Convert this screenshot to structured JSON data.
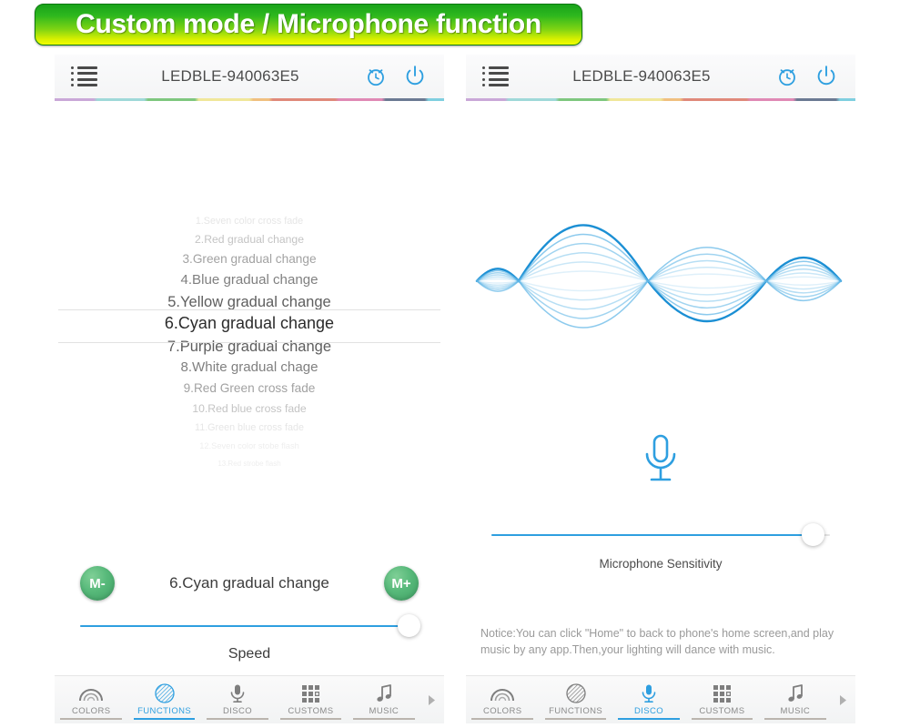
{
  "banner": {
    "text": "Custom mode / Microphone function"
  },
  "colors": {
    "accent_blue": "#2e9fe0",
    "green_button": "#57b97a",
    "banner_green": "#18a21a",
    "banner_yellow": "#f2ff00",
    "tab_inactive": "#8a8a8a",
    "selected_text": "#3c3c3c"
  },
  "phone_left": {
    "topbar": {
      "menu_icon": "list-menu-icon",
      "title": "LEDBLE-940063E5",
      "alarm_icon": "alarm-clock-icon",
      "power_icon": "power-icon"
    },
    "picker": {
      "selected_index": 5,
      "items": [
        "1.Seven color cross fade",
        "2.Red  gradual change",
        "3.Green gradual change",
        "4.Blue gradual change",
        "5.Yellow gradual change",
        "6.Cyan gradual change",
        "7.Purple gradual change",
        "8.White gradual chage",
        "9.Red Green cross fade",
        "10.Red blue cross fade",
        "11.Green blue cross fade",
        "12.Seven color stobe flash",
        "13.Red strobe flash"
      ]
    },
    "mode_row": {
      "minus_label": "M-",
      "current_mode": "6.Cyan gradual change",
      "plus_label": "M+"
    },
    "slider": {
      "caption": "Speed",
      "value_percent": 97
    },
    "tabs": [
      {
        "label": "COLORS",
        "icon": "rainbow-arc-icon",
        "active": false
      },
      {
        "label": "FUNCTIONS",
        "icon": "striped-circle-icon",
        "active": true
      },
      {
        "label": "DISCO",
        "icon": "microphone-icon",
        "active": false
      },
      {
        "label": "CUSTOMS",
        "icon": "grid-icon",
        "active": false
      },
      {
        "label": "MUSIC",
        "icon": "music-note-icon",
        "active": false
      }
    ],
    "tab_arrow": "chevron-right-icon"
  },
  "phone_right": {
    "topbar": {
      "menu_icon": "list-menu-icon",
      "title": "LEDBLE-940063E5",
      "alarm_icon": "alarm-clock-icon",
      "power_icon": "power-icon"
    },
    "waveform": {
      "icon": "audio-waveform-visualizer",
      "layers": 6
    },
    "mic_icon": "microphone-icon",
    "slider": {
      "caption": "Microphone Sensitivity",
      "value_percent": 95
    },
    "notice": "Notice:You can click \"Home\" to back to phone's home screen,and play music by any app.Then,your lighting will dance with music.",
    "tabs": [
      {
        "label": "COLORS",
        "icon": "rainbow-arc-icon",
        "active": false
      },
      {
        "label": "FUNCTIONS",
        "icon": "striped-circle-icon",
        "active": false
      },
      {
        "label": "DISCO",
        "icon": "microphone-icon",
        "active": true
      },
      {
        "label": "CUSTOMS",
        "icon": "grid-icon",
        "active": false
      },
      {
        "label": "MUSIC",
        "icon": "music-note-icon",
        "active": false
      }
    ],
    "tab_arrow": "chevron-right-icon"
  }
}
